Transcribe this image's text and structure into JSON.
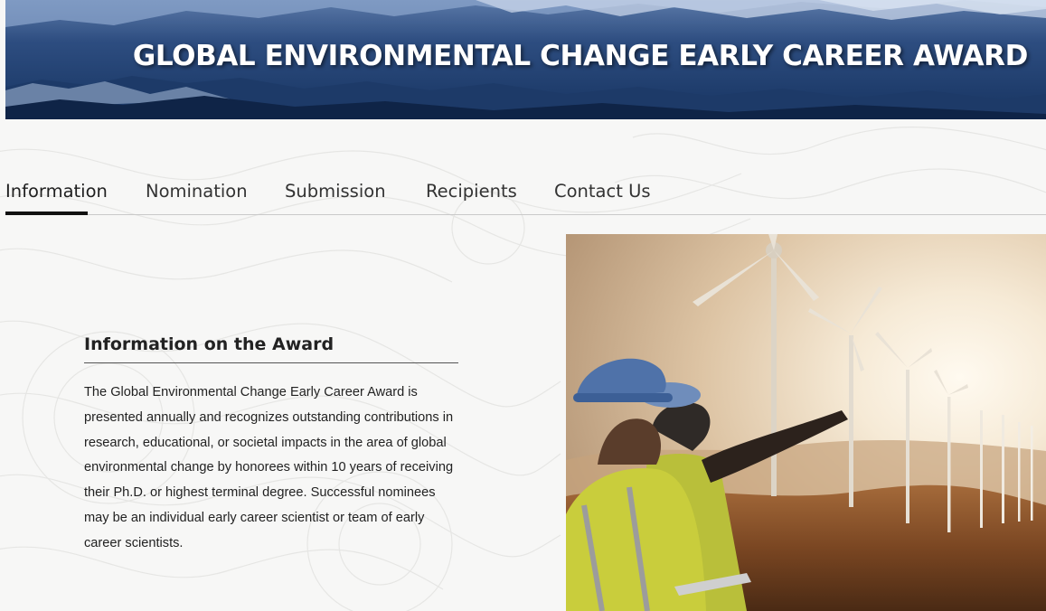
{
  "banner": {
    "title": "GLOBAL ENVIRONMENTAL CHANGE EARLY CAREER AWARD"
  },
  "tabs": [
    {
      "label": "Information",
      "active": true
    },
    {
      "label": "Nomination",
      "active": false
    },
    {
      "label": "Submission",
      "active": false
    },
    {
      "label": "Recipients",
      "active": false
    },
    {
      "label": "Contact Us",
      "active": false
    }
  ],
  "info": {
    "heading": "Information on the Award",
    "body": "The Global Environmental Change Early Career Award is presented annually and recognizes outstanding contributions in research, educational, or societal impacts in the area of global environmental change by honorees within 10 years of receiving their Ph.D. or highest terminal degree. Successful nominees may be an individual early career scientist or team of early career scientists."
  },
  "colors": {
    "banner_dark": "#1b3868",
    "banner_light": "#4d6c9c",
    "tab_underline": "#111111",
    "sunset_light": "#f3e7d3",
    "vest_yellow": "#c4c93a",
    "helmet_blue": "#4f72a9"
  },
  "photo": {
    "description_icon": "wind-turbine-workers-photo"
  }
}
